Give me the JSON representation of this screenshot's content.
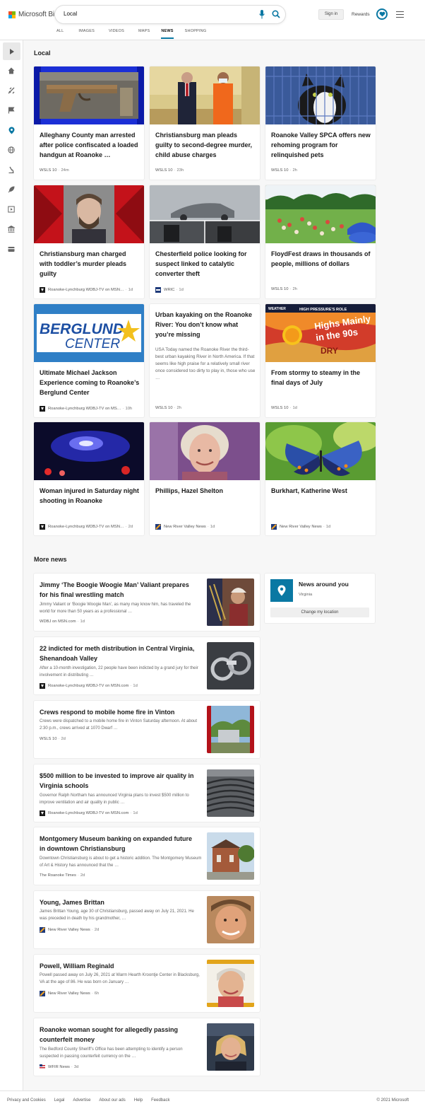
{
  "header": {
    "logo_text": "Microsoft Bing",
    "search_value": "Local",
    "signin_label": "Sign in",
    "rewards_label": "Rewards",
    "tabs": [
      "ALL",
      "IMAGES",
      "VIDEOS",
      "MAPS",
      "NEWS",
      "SHOPPING"
    ],
    "active_tab": "NEWS",
    "accent_color": "#0a78a3"
  },
  "sidebar": {
    "icons": [
      "expand-icon",
      "home-icon",
      "satellite-icon",
      "flag-icon",
      "location-pin-icon",
      "globe-icon",
      "microscope-icon",
      "rocket-icon",
      "video-icon",
      "bank-icon",
      "credit-card-icon"
    ],
    "active_icon": "location-pin-icon"
  },
  "local": {
    "title": "Local",
    "cards": [
      {
        "title": "Alleghany County man arrested after police confiscated a loaded handgun at Roanoke …",
        "source": "WSLS 10",
        "age": "24m"
      },
      {
        "title": "Christiansburg man pleads guilty to second-degree murder, child abuse charges",
        "source": "WSLS 10",
        "age": "23h"
      },
      {
        "title": "Roanoke Valley SPCA offers new rehoming program for relinquished pets",
        "source": "WSLS 10",
        "age": "2h"
      },
      {
        "title": "Christiansburg man charged with toddler’s murder pleads guilty",
        "source": "Roanoke-Lynchburg WDBJ-TV on MSN…",
        "age": "1d"
      },
      {
        "title": "Chesterfield police looking for suspect linked to catalytic converter theft",
        "source": "WRIC",
        "age": "1d"
      },
      {
        "title": "FloydFest draws in thousands of people, millions of dollars",
        "source": "WSLS 10",
        "age": "2h"
      },
      {
        "title": "Ultimate Michael Jackson Experience coming to Roanoke’s Berglund Center",
        "source": "Roanoke-Lynchburg WDBJ-TV on MS…",
        "age": "10h",
        "image_text": [
          "BERGLUND",
          "CENTER"
        ]
      },
      {
        "title": "Urban kayaking on the Roanoke River: You don’t know what you’re missing",
        "snippet": "USA Today named the Roanoke River the third-best urban kayaking River in North America. If that seems like high praise for a relatively small river once considered too dirty to play in, those who use …",
        "source": "WSLS 10",
        "age": "2h"
      },
      {
        "title": "From stormy to steamy in the final days of July",
        "source": "WSLS 10",
        "age": "1d",
        "image_text": [
          "WEATHER",
          "HIGH PRESSURE'S ROLE",
          "Highs Mainly",
          "in the 90s",
          "DRY"
        ]
      },
      {
        "title": "Woman injured in Saturday night shooting in Roanoke",
        "source": "Roanoke-Lynchburg WDBJ-TV on MSN…",
        "age": "2d"
      },
      {
        "title": "Phillips, Hazel Shelton",
        "source": "New River Valley News",
        "age": "1d"
      },
      {
        "title": "Burkhart, Katherine West",
        "source": "New River Valley News",
        "age": "1d"
      }
    ]
  },
  "more_news": {
    "title": "More news",
    "items": [
      {
        "title": "Jimmy ‘The Boogie Woogie Man’ Valiant prepares for his final wrestling match",
        "snippet": "Jimmy Valiant or ‘Boogie Woogie Man’, as many may know him, has traveled the world for more than 50 years as a professional …",
        "source": "WDBJ on MSN.com",
        "age": "1d"
      },
      {
        "title": "22 indicted for meth distribution in Central Virginia, Shenandoah Valley",
        "snippet": "After a 10-month investigation, 22 people have been indicted by a grand jury for their involvement in distributing …",
        "source": "Roanoke-Lynchburg WDBJ-TV on MSN.com",
        "age": "1d"
      },
      {
        "title": "Crews respond to mobile home fire in Vinton",
        "snippet": "Crews were dispatched to a mobile home fire in Vinton Saturday afternoon. At about 2:30 p.m., crews arrived at 1070 Dwarf …",
        "source": "WSLS 10",
        "age": "2d"
      },
      {
        "title": "$500 million to be invested to improve air quality in Virginia schools",
        "snippet": "Governor Ralph Northam has announced Virginia plans to invest $500 million to improve ventilation and air quality in public …",
        "source": "Roanoke-Lynchburg WDBJ-TV on MSN.com",
        "age": "1d"
      },
      {
        "title": "Montgomery Museum banking on expanded future in downtown Christiansburg",
        "snippet": "Downtown Christiansburg is about to get a historic addition. The Montgomery Museum of Art & History has announced that the …",
        "source": "The Roanoke Times",
        "age": "2d"
      },
      {
        "title": "Young, James Brittan",
        "snippet": "James Brittan Young, age 30 of Christiansburg, passed away on July 21, 2021. He was preceded in death by his grandmother, …",
        "source": "New River Valley News",
        "age": "2d"
      },
      {
        "title": "Powell, William Reginald",
        "snippet": "Powell passed away on July 26, 2021 at Warm Hearth Kroontje Center in Blacksburg, VA at the age of 86. He was born on January …",
        "source": "New River Valley News",
        "age": "6h"
      },
      {
        "title": "Roanoke woman sought for allegedly passing counterfeit money",
        "snippet": "The Bedford County Sheriff’s Office has been attempting to identify a person suspected in passing counterfeit currency on the …",
        "source": "WFIR News",
        "age": "3d"
      }
    ]
  },
  "location": {
    "title": "News around you",
    "region": "Virginia",
    "button_label": "Change my location"
  },
  "footer": {
    "links": [
      "Privacy and Cookies",
      "Legal",
      "Advertise",
      "About our ads",
      "Help",
      "Feedback"
    ],
    "copyright": "© 2021 Microsoft"
  }
}
